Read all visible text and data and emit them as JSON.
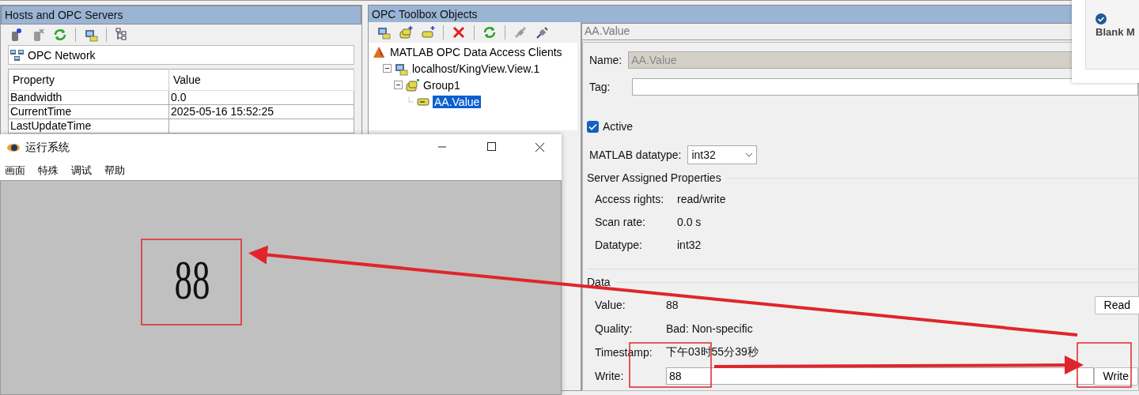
{
  "hosts_panel": {
    "title": "Hosts and OPC Servers",
    "tree": [
      {
        "label": "OPC Network"
      }
    ],
    "table": {
      "columns": [
        "Property",
        "Value"
      ],
      "rows": [
        [
          "Bandwidth",
          "0.0"
        ],
        [
          "CurrentTime",
          "2025-05-16 15:52:25"
        ],
        [
          "LastUpdateTime"
        ]
      ]
    }
  },
  "objects_panel": {
    "title": "OPC Toolbox Objects",
    "tree": [
      {
        "label": "MATLAB OPC Data Access Clients",
        "kind": "root",
        "selected": false,
        "children": [
          {
            "label": "localhost/KingView.View.1",
            "kind": "client",
            "selected": false,
            "expanded": true,
            "children": [
              {
                "label": "Group1",
                "kind": "group",
                "selected": false,
                "expanded": true,
                "children": [
                  {
                    "label": "AA.Value",
                    "kind": "item",
                    "selected": true
                  }
                ]
              }
            ]
          }
        ]
      }
    ]
  },
  "properties": {
    "heading": "AA.Value",
    "name": {
      "label": "Name:",
      "value": "AA.Value",
      "disabled": true
    },
    "tag": {
      "label": "Tag:"
    },
    "active": {
      "label": "Active",
      "checked": true
    },
    "datatype": {
      "label": "MATLAB datatype:",
      "value": "int32"
    },
    "server_properties": {
      "title": "Server Assigned Properties",
      "rows": [
        {
          "label": "Access rights:",
          "value": "read/write"
        },
        {
          "label": "Scan rate:",
          "value": "0.0 s"
        },
        {
          "label": "Datatype:",
          "value": "int32"
        }
      ]
    },
    "data": {
      "title": "Data",
      "rows": [
        {
          "label": "Value:",
          "value": "88"
        },
        {
          "label": "Quality:",
          "value": "Bad: Non-specific"
        },
        {
          "label": "Timestamp:",
          "value": "下午03时55分39秒"
        }
      ],
      "write": {
        "label": "Write:",
        "value": "88"
      },
      "read_button": "Read",
      "write_button": "Write"
    }
  },
  "popup": {
    "label": "Blank M"
  },
  "runtime_window": {
    "title": "运行系统",
    "menu": [
      "画面",
      "特殊",
      "调试",
      "帮助"
    ],
    "display": "88"
  }
}
